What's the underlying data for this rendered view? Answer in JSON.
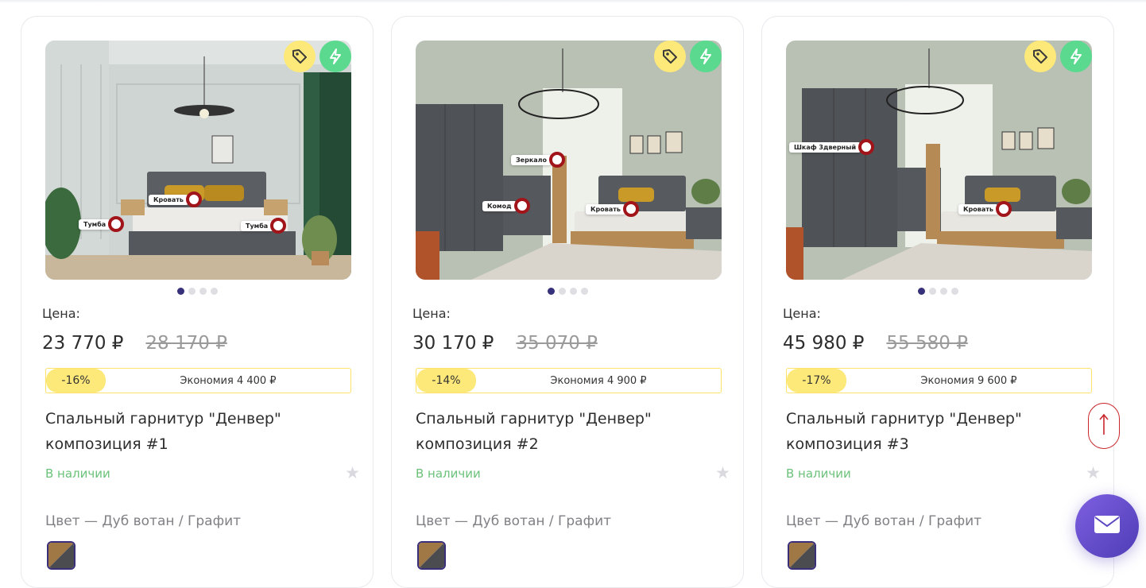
{
  "products": [
    {
      "price_label": "Цена:",
      "price": "23 770 ₽",
      "old_price": "28 170 ₽",
      "discount": "-16%",
      "savings": "Экономия 4 400 ₽",
      "title": "Спальный гарнитур \"Денвер\" композиция #1",
      "stock": "В наличии",
      "color_line": "Цвет  —  Дуб вотан / Графит",
      "hotspots": [
        "Кровать",
        "Тумба",
        "Тумба"
      ]
    },
    {
      "price_label": "Цена:",
      "price": "30 170 ₽",
      "old_price": "35 070 ₽",
      "discount": "-14%",
      "savings": "Экономия 4 900 ₽",
      "title": "Спальный гарнитур \"Денвер\" композиция #2",
      "stock": "В наличии",
      "color_line": "Цвет  —  Дуб вотан / Графит",
      "hotspots": [
        "Зеркало",
        "Комод",
        "Кровать"
      ]
    },
    {
      "price_label": "Цена:",
      "price": "45 980 ₽",
      "old_price": "55 580 ₽",
      "discount": "-17%",
      "savings": "Экономия 9 600 ₽",
      "title": "Спальный гарнитур \"Денвер\" композиция #3",
      "stock": "В наличии",
      "color_line": "Цвет  —  Дуб вотан / Графит",
      "hotspots": [
        "Шкаф 3дверный",
        "Кровать"
      ]
    }
  ],
  "icons": {
    "discount_badge": "price-tag-icon",
    "fast_badge": "lightning-icon",
    "favorite": "star-icon",
    "scroll_top": "arrow-up-icon",
    "contact": "mail-icon"
  },
  "colors": {
    "accent_purple": "#37307a",
    "discount_yellow": "#fde97a",
    "in_stock_green": "#6cc27a",
    "fast_green": "#5ad98f",
    "scroll_top_red": "#c9272c"
  }
}
